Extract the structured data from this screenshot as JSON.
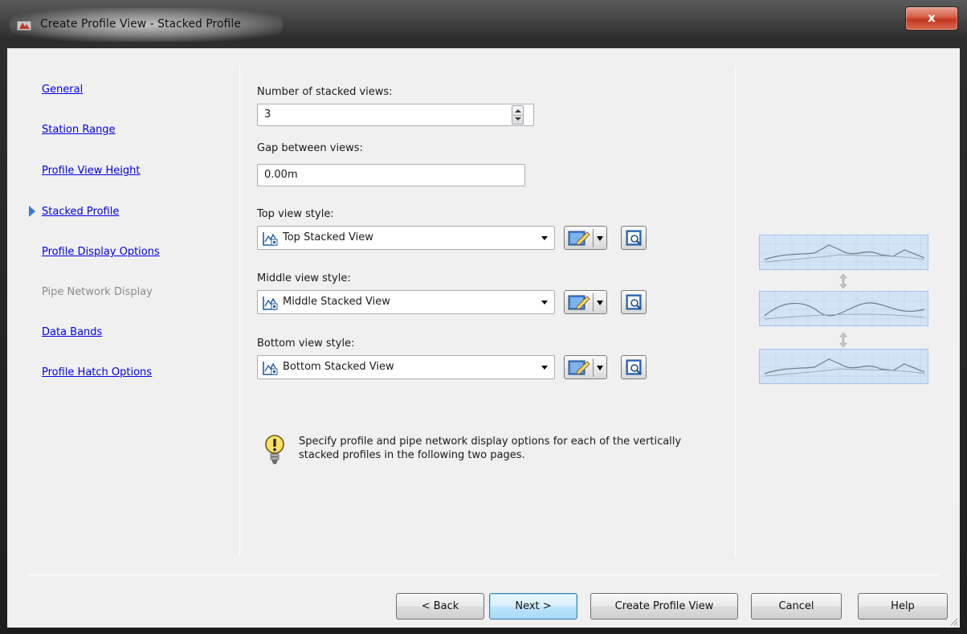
{
  "window": {
    "title": "Create Profile View - Stacked Profile",
    "close_label": "x"
  },
  "nav": {
    "items": [
      {
        "label": "General",
        "state": "link"
      },
      {
        "label": "Station Range",
        "state": "link"
      },
      {
        "label": "Profile View Height",
        "state": "link"
      },
      {
        "label": "Stacked Profile",
        "state": "current"
      },
      {
        "label": "Profile Display Options",
        "state": "link"
      },
      {
        "label": "Pipe Network Display",
        "state": "disabled"
      },
      {
        "label": "Data Bands",
        "state": "link"
      },
      {
        "label": "Profile Hatch Options",
        "state": "link"
      }
    ]
  },
  "form": {
    "stacked_count_label": "Number of stacked views:",
    "stacked_count_value": "3",
    "gap_label": "Gap between views:",
    "gap_value": "0.00m",
    "top_label": "Top view style:",
    "top_value": "Top Stacked View",
    "middle_label": "Middle view style:",
    "middle_value": "Middle Stacked View",
    "bottom_label": "Bottom view style:",
    "bottom_value": "Bottom Stacked View"
  },
  "tip": {
    "icon": "lightbulb-icon",
    "text": "Specify profile and pipe network display options for each of the vertically stacked profiles in the following two pages."
  },
  "buttons": {
    "back": "< Back",
    "next": "Next >",
    "create": "Create Profile View",
    "cancel": "Cancel",
    "help": "Help"
  },
  "colors": {
    "accent": "#2f7fd8",
    "link": "#0000ee",
    "disabled": "#8a8a8a",
    "preview_fill": "#d3e3f6",
    "close_red": "#c2381f"
  }
}
